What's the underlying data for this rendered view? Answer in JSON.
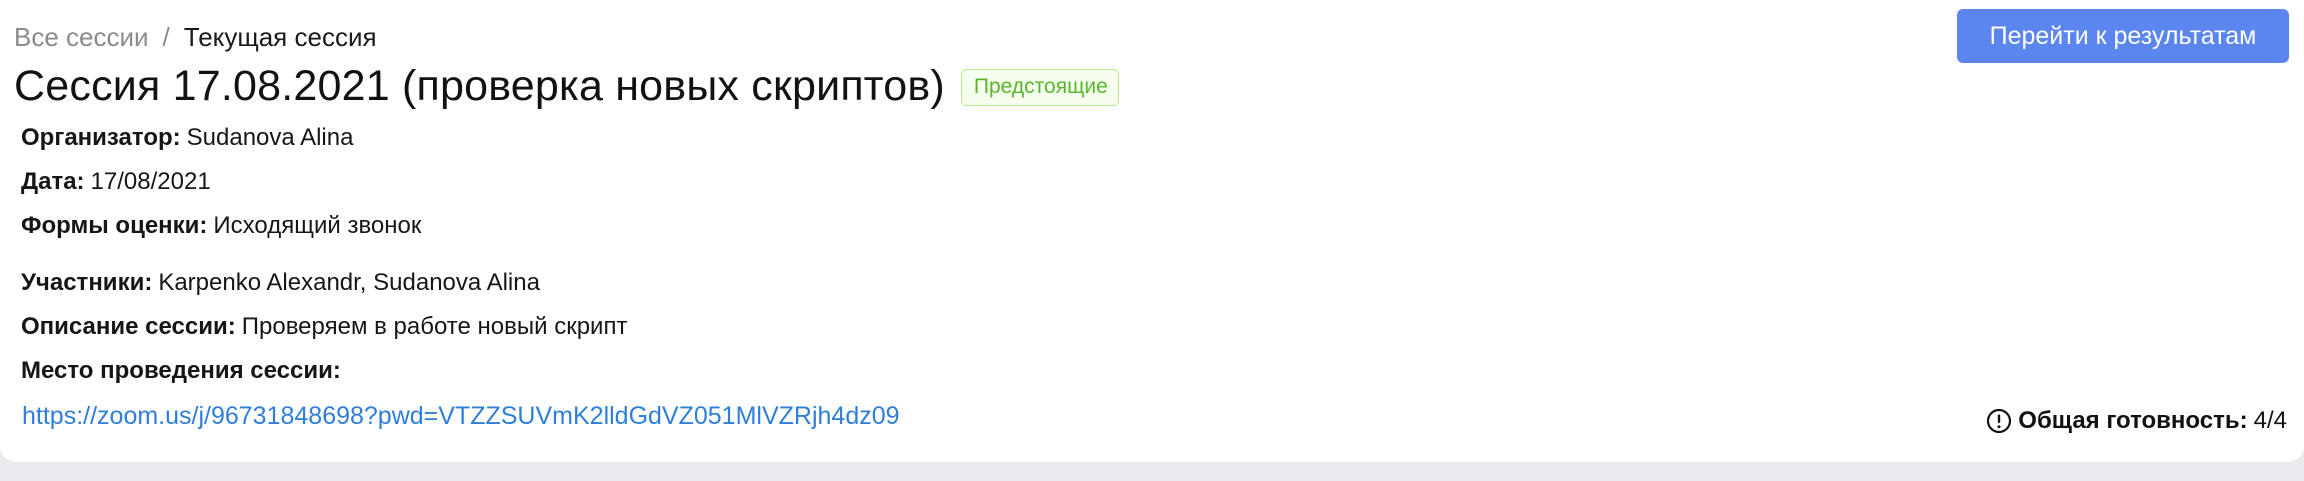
{
  "breadcrumb": {
    "all_sessions": "Все сессии",
    "separator": "/",
    "current": "Текущая сессия"
  },
  "session": {
    "title": "Сессия 17.08.2021 (проверка новых скриптов)",
    "status": "Предстоящие",
    "status_color": "#56b72e"
  },
  "actions": {
    "results_button": "Перейти к результатам",
    "results_button_color": "#5b86f0"
  },
  "details": {
    "organizer_label": "Организатор:",
    "organizer_value": "Sudanova Alina",
    "date_label": "Дата:",
    "date_value": "17/08/2021",
    "forms_label": "Формы оценки:",
    "forms_value": "Исходящий звонок",
    "participants_label": "Участники:",
    "participants_value": "Karpenko Alexandr, Sudanova Alina",
    "description_label": "Описание сессии:",
    "description_value": "Проверяем в работе новый скрипт",
    "location_label": "Место проведения сессии:",
    "location_link": "https://zoom.us/j/96731848698?pwd=VTZZSUVmK2lldGdVZ051MlVZRjh4dz09",
    "link_color": "#2f7ed8"
  },
  "readiness": {
    "icon": "exclamation-circle-icon",
    "label": "Общая готовность:",
    "value": "4/4"
  }
}
